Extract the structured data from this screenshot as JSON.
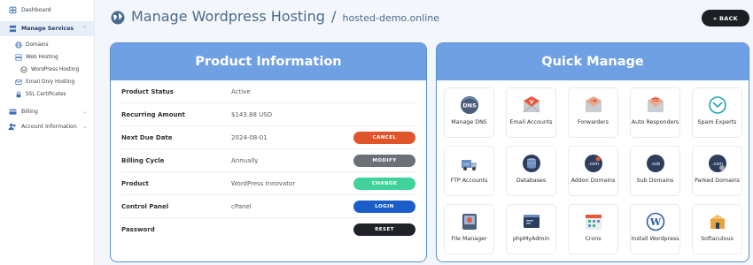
{
  "sidebar": {
    "dashboard": "Dashboard",
    "manage_services": "Manage Services",
    "domains": "Domains",
    "web_hosting": "Web Hosting",
    "wordpress_hosting": "WordPress Hosting",
    "email_only_hosting": "Email Only Hosting",
    "ssl_certificates": "SSL Certificates",
    "billing": "Billing",
    "account_information": "Account Information"
  },
  "header": {
    "title": "Manage Wordpress Hosting",
    "separator": "/",
    "domain": "hosted-demo.online",
    "back_label": "« BACK"
  },
  "product": {
    "heading": "Product Information",
    "rows": [
      {
        "label": "Product Status",
        "value": "Active"
      },
      {
        "label": "Recurring Amount",
        "value": "$143.88 USD"
      },
      {
        "label": "Next Due Date",
        "value": "2024-08-01",
        "action": "CANCEL"
      },
      {
        "label": "Billing Cycle",
        "value": "Annually",
        "action": "MODIFY"
      },
      {
        "label": "Product",
        "value": "WordPress Innovator",
        "action": "CHANGE"
      },
      {
        "label": "Control Panel",
        "value": "cPanel",
        "action": "LOGIN"
      },
      {
        "label": "Password",
        "value": "",
        "action": "RESET"
      }
    ]
  },
  "quick": {
    "heading": "Quick Manage",
    "tiles": [
      {
        "label": "Manage DNS",
        "icon": "dns-icon"
      },
      {
        "label": "Email Accounts",
        "icon": "email-accounts-icon"
      },
      {
        "label": "Forwarders",
        "icon": "forwarders-icon"
      },
      {
        "label": "Auto Responders",
        "icon": "auto-responders-icon"
      },
      {
        "label": "Spam Experts",
        "icon": "spam-experts-icon"
      },
      {
        "label": "FTP Accounts",
        "icon": "ftp-icon"
      },
      {
        "label": "Databases",
        "icon": "database-icon"
      },
      {
        "label": "Addon Domains",
        "icon": "addon-domains-icon"
      },
      {
        "label": "Sub Domains",
        "icon": "sub-domains-icon"
      },
      {
        "label": "Parked Domains",
        "icon": "parked-domains-icon"
      },
      {
        "label": "File Manager",
        "icon": "file-manager-icon"
      },
      {
        "label": "phpMyAdmin",
        "icon": "phpmyadmin-icon"
      },
      {
        "label": "Crons",
        "icon": "crons-icon"
      },
      {
        "label": "Install Wordpress",
        "icon": "wordpress-icon"
      },
      {
        "label": "Softaculous",
        "icon": "softaculous-icon"
      }
    ]
  },
  "colors": {
    "panel_header": "#6ea0e3",
    "cancel": "#e0542a",
    "modify": "#6c7178",
    "change": "#3fd39a",
    "login": "#1b5ec9",
    "reset": "#1f2226"
  }
}
